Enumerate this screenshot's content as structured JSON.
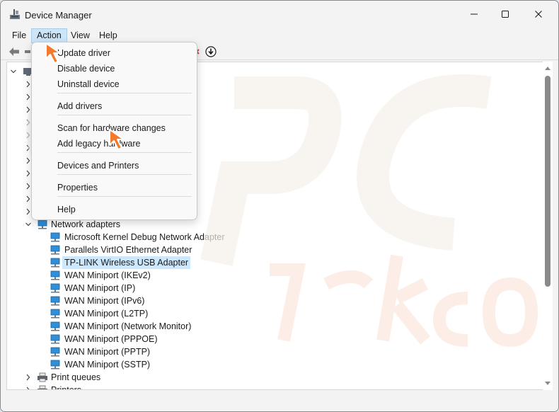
{
  "window": {
    "title": "Device Manager"
  },
  "menu": {
    "file": "File",
    "action": "Action",
    "view": "View",
    "help": "Help"
  },
  "action_menu": {
    "items": [
      {
        "label": "Update driver"
      },
      {
        "label": "Disable device"
      },
      {
        "label": "Uninstall device"
      },
      {
        "label": "Add drivers"
      },
      {
        "label": "Scan for hardware changes"
      },
      {
        "label": "Add legacy hardware"
      },
      {
        "label": "Devices and Printers"
      },
      {
        "label": "Properties"
      },
      {
        "label": "Help"
      }
    ]
  },
  "tree": {
    "network_adapters": "Network adapters",
    "adapters": [
      "Microsoft Kernel Debug Network Adapter",
      "Parallels VirtIO Ethernet Adapter",
      "TP-LINK Wireless USB Adapter",
      "WAN Miniport (IKEv2)",
      "WAN Miniport (IP)",
      "WAN Miniport (IPv6)",
      "WAN Miniport (L2TP)",
      "WAN Miniport (Network Monitor)",
      "WAN Miniport (PPPOE)",
      "WAN Miniport (PPTP)",
      "WAN Miniport (SSTP)"
    ],
    "selected_adapter": "TP-LINK Wireless USB Adapter",
    "print_queues": "Print queues",
    "printers": "Printers"
  },
  "colors": {
    "accent": "#0067c0",
    "selection": "#cce8ff",
    "menu_highlight": "#cde5f7",
    "arrow": "#f47a2b"
  }
}
